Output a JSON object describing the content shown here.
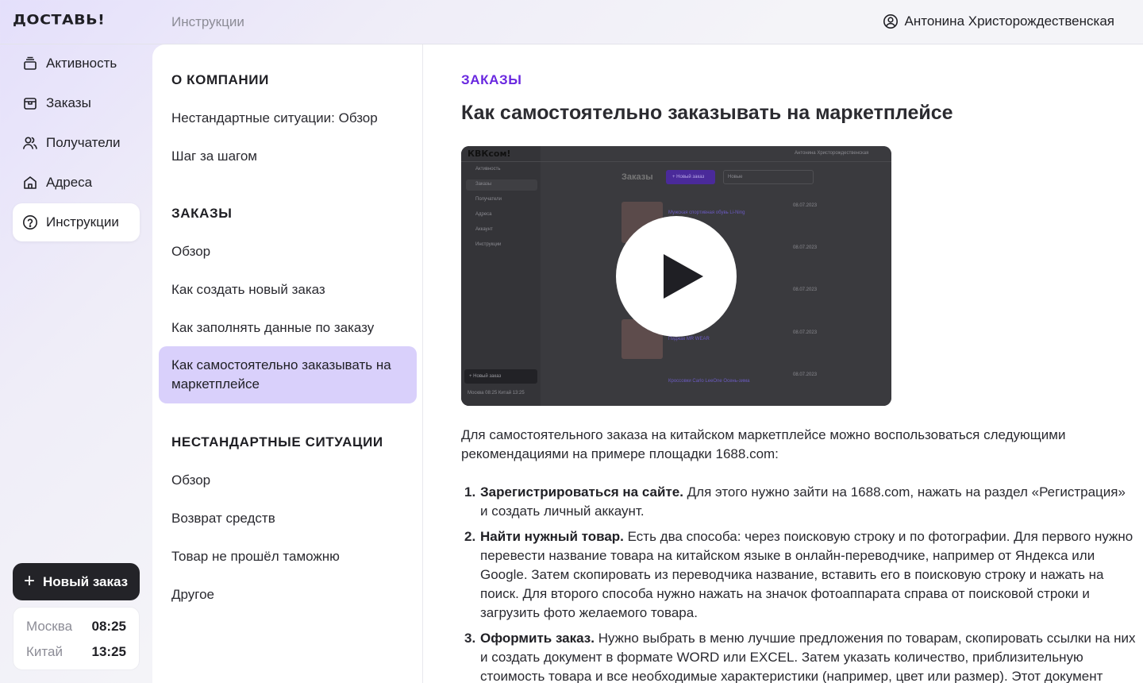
{
  "app": {
    "logo": "ДОСТАВЬ!",
    "breadcrumb": "Инструкции",
    "user_name": "Антонина Христорождественская"
  },
  "nav": {
    "items": [
      {
        "label": "Активность",
        "icon": "activity-icon"
      },
      {
        "label": "Заказы",
        "icon": "box-icon"
      },
      {
        "label": "Получатели",
        "icon": "users-icon"
      },
      {
        "label": "Адреса",
        "icon": "home-icon"
      },
      {
        "label": "Инструкции",
        "icon": "help-circle-icon",
        "active": true
      }
    ],
    "new_order_label": "Новый заказ",
    "clocks": [
      {
        "city": "Москва",
        "time": "08:25"
      },
      {
        "city": "Китай",
        "time": "13:25"
      }
    ]
  },
  "toc": {
    "sections": [
      {
        "title": "О КОМПАНИИ",
        "links": [
          "Нестандартные ситуации: Обзор",
          "Шаг за шагом"
        ]
      },
      {
        "title": "ЗАКАЗЫ",
        "links": [
          "Обзор",
          "Как создать новый заказ",
          "Как заполнять данные по заказу",
          "Как самостоятельно заказывать на маркетплейсе"
        ],
        "active_index": 3
      },
      {
        "title": "НЕСТАНДАРТНЫЕ СИТУАЦИИ",
        "links": [
          "Обзор",
          "Возврат средств",
          "Товар не прошёл таможню",
          "Другое"
        ]
      }
    ]
  },
  "article": {
    "kicker": "ЗАКАЗЫ",
    "title": "Как самостоятельно заказывать на маркетплейсе",
    "intro": "Для самостоятельного заказа на китайском маркетплейсе можно воспользоваться следующими рекомендациями на примере площадки 1688.com:",
    "steps": [
      {
        "num": "1.",
        "bold": "Зарегистрироваться на сайте.",
        "text": " Для этого нужно зайти на 1688.com, нажать на раздел «Регистрация» и создать личный аккаунт."
      },
      {
        "num": "2.",
        "bold": "Найти нужный товар.",
        "text": " Есть два способа: через поисковую строку и по фотографии. Для первого нужно перевести название товара на китайском языке в онлайн-переводчике, например от Яндекса или Google. Затем скопировать из переводчика название, вставить его в поисковую строку и нажать на поиск. Для второго способа нужно нажать на значок фотоаппарата справа от поисковой строки и загрузить фото желаемого товара."
      },
      {
        "num": "3.",
        "bold": "Оформить заказ.",
        "text": " Нужно выбрать в меню лучшие предложения по товарам, скопировать ссылки на них и создать документ в формате WORD или EXCEL. Затем указать количество, приблизительную стоимость товара и все необходимые характеристики (например, цвет или размер). Этот документ"
      }
    ]
  },
  "video_preview": {
    "logo": "КВКсом!",
    "user": "Антонина Христорождественская",
    "heading": "Заказы",
    "button": "+ Новый заказ",
    "filter": "Новые",
    "nav": [
      "Активность",
      "Заказы",
      "Получатели",
      "Адреса",
      "Аккаунт",
      "Инструкции"
    ],
    "items": [
      {
        "title": "Мужская спортивная обувь Li-Ning",
        "date": "08.07.2023"
      },
      {
        "title": "",
        "date": "08.07.2023"
      },
      {
        "title": "",
        "date": "08.07.2023"
      },
      {
        "title": "Пиджак MR WEAR",
        "date": "08.07.2023"
      },
      {
        "title": "Кроссовки Carlo LeeOne Осень-зима",
        "date": "08.07.2023"
      }
    ],
    "new_order": "+ Новый заказ",
    "clock": "Москва 08:25  Китай 13:25",
    "accent": "#5a2bd6"
  },
  "colors": {
    "accent": "#6a28e0",
    "active_toc_bg": "#d9d0fb",
    "dark_button": "#232328"
  }
}
